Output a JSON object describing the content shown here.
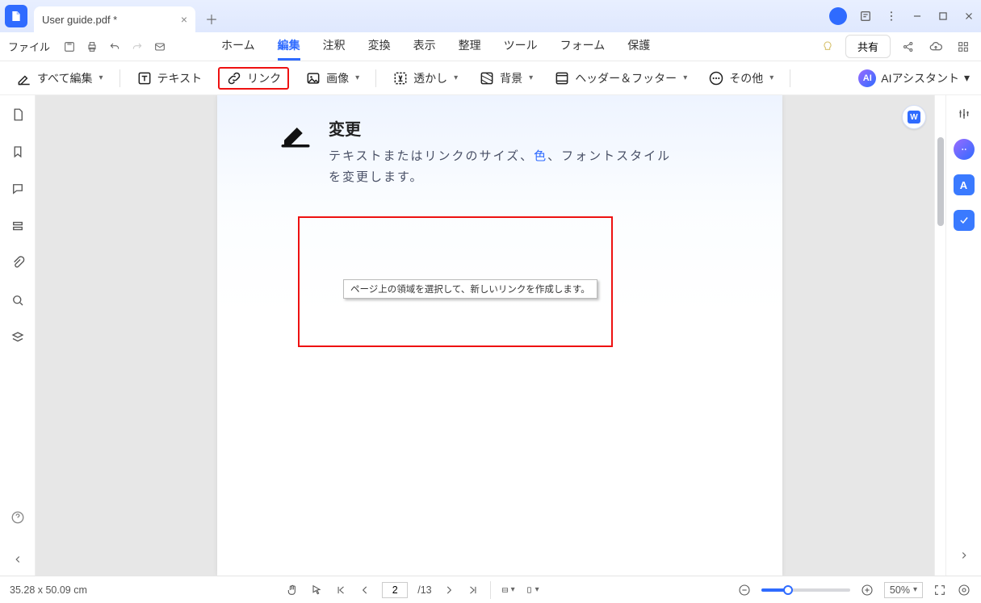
{
  "titlebar": {
    "tab_title": "User guide.pdf *"
  },
  "menubar": {
    "file": "ファイル",
    "tabs": [
      "ホーム",
      "編集",
      "注釈",
      "変換",
      "表示",
      "整理",
      "ツール",
      "フォーム",
      "保護"
    ],
    "active_index": 1,
    "share": "共有"
  },
  "ribbon": {
    "edit_all": "すべて編集",
    "text": "テキスト",
    "link": "リンク",
    "image": "画像",
    "watermark": "透かし",
    "background": "背景",
    "header_footer": "ヘッダー＆フッター",
    "other": "その他",
    "ai": "AIアシスタント"
  },
  "doc": {
    "heading": "変更",
    "sub_a": "テキストまたはリンクのサイズ、",
    "sub_blue": "色",
    "sub_b": "、フォントスタイルを変更します。",
    "tooltip": "ページ上の領域を選択して、新しいリンクを作成します。"
  },
  "status": {
    "pos": "35.28 x 50.09 cm",
    "page_current": "2",
    "page_total": "/13",
    "zoom": "50%"
  }
}
